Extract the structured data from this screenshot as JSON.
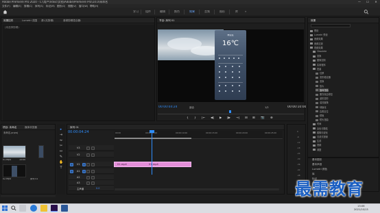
{
  "window": {
    "title": "Adobe Premiere Pro 2020 - C:\\用户\\Vdisc\\文档\\Adobe\\Premiere Pro\\14.0\\未命名",
    "minimize": "—",
    "maximize": "☐",
    "close": "✕"
  },
  "menu": [
    "文件(F)",
    "编辑(E)",
    "剪辑(C)",
    "序列(S)",
    "标记(M)",
    "图形(G)",
    "视图(V)",
    "窗口(W)",
    "帮助(H)"
  ],
  "workspaces": {
    "items": [
      "学习",
      "组件",
      "编辑",
      "颜色",
      "效果",
      "音频",
      "图形",
      "库"
    ],
    "active_index": 4
  },
  "source_panel": {
    "tabs": [
      "效果控件",
      "Lumetri 范围",
      "源:(无剪辑)",
      "音频剪辑混合器:"
    ],
    "active_tab": 0,
    "empty_text": "(未选择剪辑)"
  },
  "program_monitor": {
    "tab": "节目: 序列 01",
    "timecode": "00:00:04:24",
    "fit": "适合",
    "resolution": "1/2",
    "duration": "00:00:10:00",
    "phone": {
      "city": "海淀区",
      "temperature": "16℃"
    },
    "controls": [
      "{",
      "}",
      "|←",
      "◀|",
      "▶",
      "|▶",
      "→|",
      "⊟",
      "⊞",
      "📷",
      "⊕"
    ]
  },
  "effects_panel": {
    "tab": "效果",
    "items": [
      {
        "label": "预设",
        "level": 0,
        "folder": true
      },
      {
        "label": "Lumetri 预设",
        "level": 0,
        "folder": true
      },
      {
        "label": "音频效果",
        "level": 0,
        "folder": true
      },
      {
        "label": "音频过渡",
        "level": 0,
        "folder": true
      },
      {
        "label": "视频效果",
        "level": 0,
        "folder": true
      },
      {
        "label": "Obsolete",
        "level": 1,
        "folder": true
      },
      {
        "label": "变换",
        "level": 1,
        "folder": true
      },
      {
        "label": "图像控制",
        "level": 1,
        "folder": true
      },
      {
        "label": "实用程序",
        "level": 1,
        "folder": true
      },
      {
        "label": "扭曲",
        "level": 1,
        "folder": true
      },
      {
        "label": "位移",
        "level": 2,
        "folder": false
      },
      {
        "label": "变形稳定器",
        "level": 2,
        "folder": false
      },
      {
        "label": "变换",
        "level": 2,
        "folder": false
      },
      {
        "label": "放大",
        "level": 2,
        "folder": false
      },
      {
        "label": "旋转扭曲",
        "level": 2,
        "folder": false
      },
      {
        "label": "果冻效应修复",
        "level": 2,
        "folder": false
      },
      {
        "label": "波形变形",
        "level": 2,
        "folder": false
      },
      {
        "label": "湍流置换",
        "level": 2,
        "folder": false
      },
      {
        "label": "球面化",
        "level": 2,
        "folder": false
      },
      {
        "label": "边角定位",
        "level": 2,
        "folder": false
      },
      {
        "label": "镜像",
        "level": 2,
        "folder": false
      },
      {
        "label": "镜头扭曲",
        "level": 2,
        "folder": false
      },
      {
        "label": "时间",
        "level": 1,
        "folder": true
      },
      {
        "label": "杂色与颗粒",
        "level": 1,
        "folder": true
      },
      {
        "label": "模糊与锐化",
        "level": 1,
        "folder": true
      },
      {
        "label": "沉浸式视频",
        "level": 1,
        "folder": true
      },
      {
        "label": "生成",
        "level": 1,
        "folder": true
      },
      {
        "label": "视频",
        "level": 1,
        "folder": true
      },
      {
        "label": "调整",
        "level": 1,
        "folder": true
      }
    ],
    "selected_index": 14,
    "bottom": [
      "基本图形",
      "基本声音",
      "Lumetri 颜色",
      "库",
      "标记",
      "历史记录",
      "信息"
    ]
  },
  "project_panel": {
    "tabs": [
      "项目: 未命名",
      "媒体浏览器"
    ],
    "file": "未命名.prproj",
    "clips": [
      {
        "name": "01.mp4",
        "duration": "10:00"
      },
      {
        "name": "02.mp4",
        "duration": ""
      },
      {
        "name": "序列 01",
        "duration": ""
      }
    ]
  },
  "timeline": {
    "tab": "序列 01",
    "timecode": "00:00:04:24",
    "ruler": [
      "00:00",
      "00:00:05:00",
      "00:00:10:00",
      "00:00:15:00",
      "00:00:20:00",
      "00:00:25:00"
    ],
    "tracks": [
      {
        "name": "V3",
        "kind": "video"
      },
      {
        "name": "V2",
        "kind": "video"
      },
      {
        "name": "V1",
        "kind": "video"
      },
      {
        "name": "A1",
        "kind": "audio"
      },
      {
        "name": "A2",
        "kind": "audio"
      },
      {
        "name": "A3",
        "kind": "audio"
      },
      {
        "name": "主声道",
        "kind": "master",
        "value": "0.0"
      }
    ],
    "clip": {
      "label": "01.mp4",
      "label2": "01.mp4",
      "color": "#e48fd9"
    }
  },
  "meter_scale": [
    "0",
    "-6",
    "-12",
    "-18",
    "-24",
    "-30",
    "-36",
    "-42",
    "-48",
    "-54",
    "dB"
  ],
  "watermark": "最需教育",
  "taskbar": {
    "time": "15:06",
    "date": "2021/10/13"
  }
}
